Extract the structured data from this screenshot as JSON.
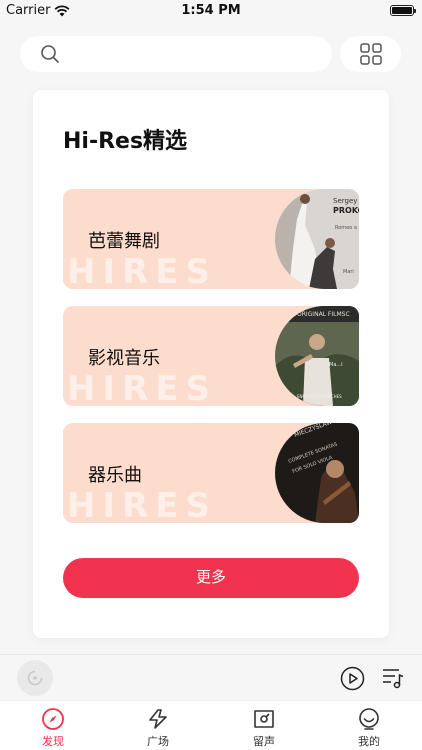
{
  "status": {
    "carrier": "Carrier",
    "time": "1:54 PM"
  },
  "card": {
    "title": "Hi-Res精选",
    "more_label": "更多"
  },
  "categories": [
    {
      "label": "芭蕾舞剧",
      "watermark": "HIRES"
    },
    {
      "label": "影视音乐",
      "watermark": "HIRES"
    },
    {
      "label": "器乐曲",
      "watermark": "HIRES"
    }
  ],
  "tabs": [
    {
      "label": "发现",
      "active": true
    },
    {
      "label": "广场",
      "active": false
    },
    {
      "label": "留声",
      "active": false
    },
    {
      "label": "我的",
      "active": false
    }
  ],
  "colors": {
    "accent": "#f2334f",
    "category_bg": "#fcdccc",
    "page_bg": "#f6f6f6"
  },
  "icons": [
    "search-icon",
    "grid-icon",
    "disc-icon",
    "play-icon",
    "playlist-icon",
    "compass-icon",
    "plaza-icon",
    "ticket-icon",
    "profile-icon"
  ]
}
